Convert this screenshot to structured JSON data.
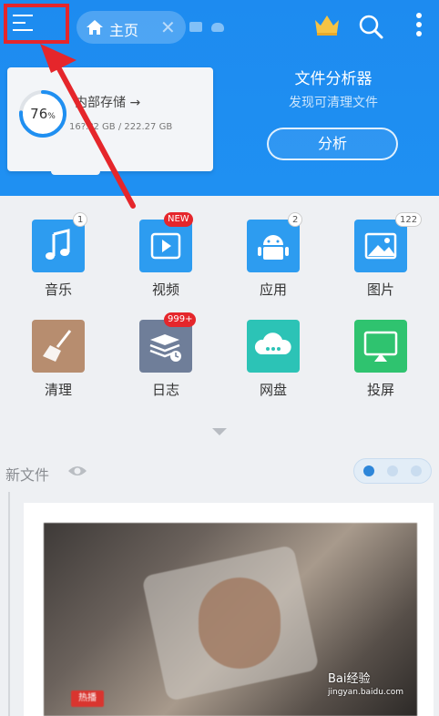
{
  "header": {
    "tab_label": "主页",
    "storage": {
      "percent_label": "76",
      "percent_unit": "%",
      "percent_value": 0.76,
      "title": "内部存储 →",
      "size": "16?.?2 GB / 222.27 GB"
    },
    "analyzer": {
      "title": "文件分析器",
      "subtitle": "发现可清理文件",
      "button": "分析"
    }
  },
  "grid": [
    {
      "label": "音乐",
      "badge": "1",
      "icon": "music-note-icon",
      "color": "#2d9cf0"
    },
    {
      "label": "视频",
      "badge": "NEW",
      "icon": "video-play-icon",
      "color": "#2d9cf0"
    },
    {
      "label": "应用",
      "badge": "2",
      "icon": "android-icon",
      "color": "#2d9cf0"
    },
    {
      "label": "图片",
      "badge": "122",
      "icon": "picture-icon",
      "color": "#2d9cf0"
    },
    {
      "label": "清理",
      "badge": "",
      "icon": "broom-icon",
      "color": "#b78d6f"
    },
    {
      "label": "日志",
      "badge": "999+",
      "icon": "log-stack-icon",
      "color": "#6f7e99"
    },
    {
      "label": "网盘",
      "badge": "",
      "icon": "cloud-drive-icon",
      "color": "#2cc3b6"
    },
    {
      "label": "投屏",
      "badge": "",
      "icon": "cast-screen-icon",
      "color": "#2fc36f"
    }
  ],
  "new_files": {
    "label": "新文件",
    "thumb_tag": "热播"
  },
  "watermark": {
    "brand": "Bai经验",
    "domain": "jingyan.baidu.com"
  },
  "colors": {
    "primary": "#1f8ff1",
    "highlight": "#e5262b",
    "badge_red": "#e5262b"
  }
}
